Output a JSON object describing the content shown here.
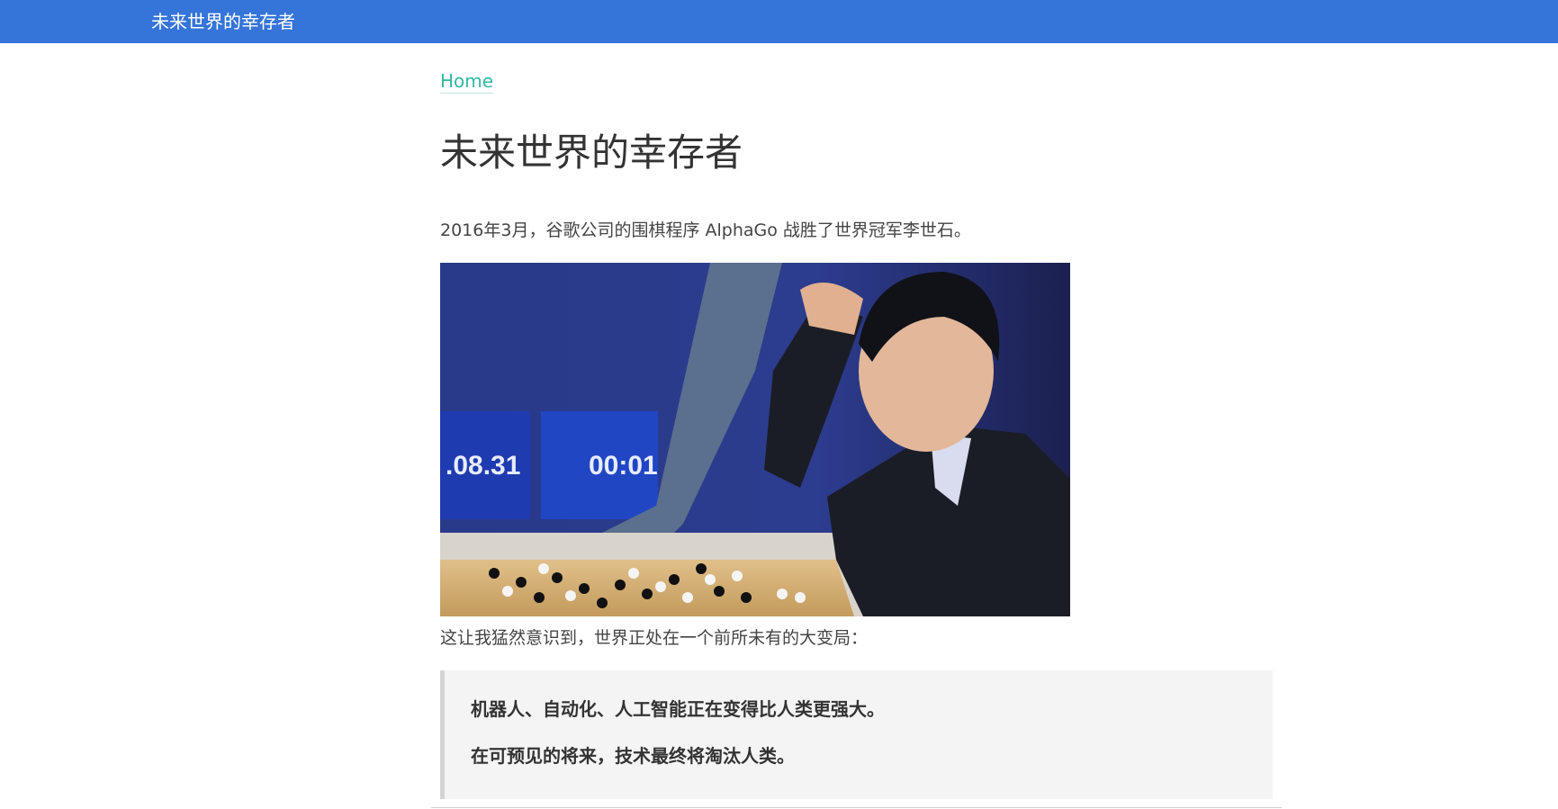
{
  "header": {
    "site_title": "未来世界的幸存者",
    "bar_color": "#3574d9"
  },
  "breadcrumb": {
    "home_label": "Home",
    "link_color": "#33b8a4"
  },
  "article": {
    "title": "未来世界的幸存者",
    "paragraph_1": "2016年3月，谷歌公司的围棋程序 AlphaGo 战胜了世界冠军李世石。",
    "image": {
      "scoreboard_left": ".08.31",
      "scoreboard_right": "00:01"
    },
    "paragraph_2": "这让我猛然意识到，世界正处在一个前所未有的大变局：",
    "blockquote": {
      "line_1": "机器人、自动化、人工智能正在变得比人类更强大。",
      "line_2": "在可预见的将来，技术最终将淘汰人类。"
    }
  }
}
